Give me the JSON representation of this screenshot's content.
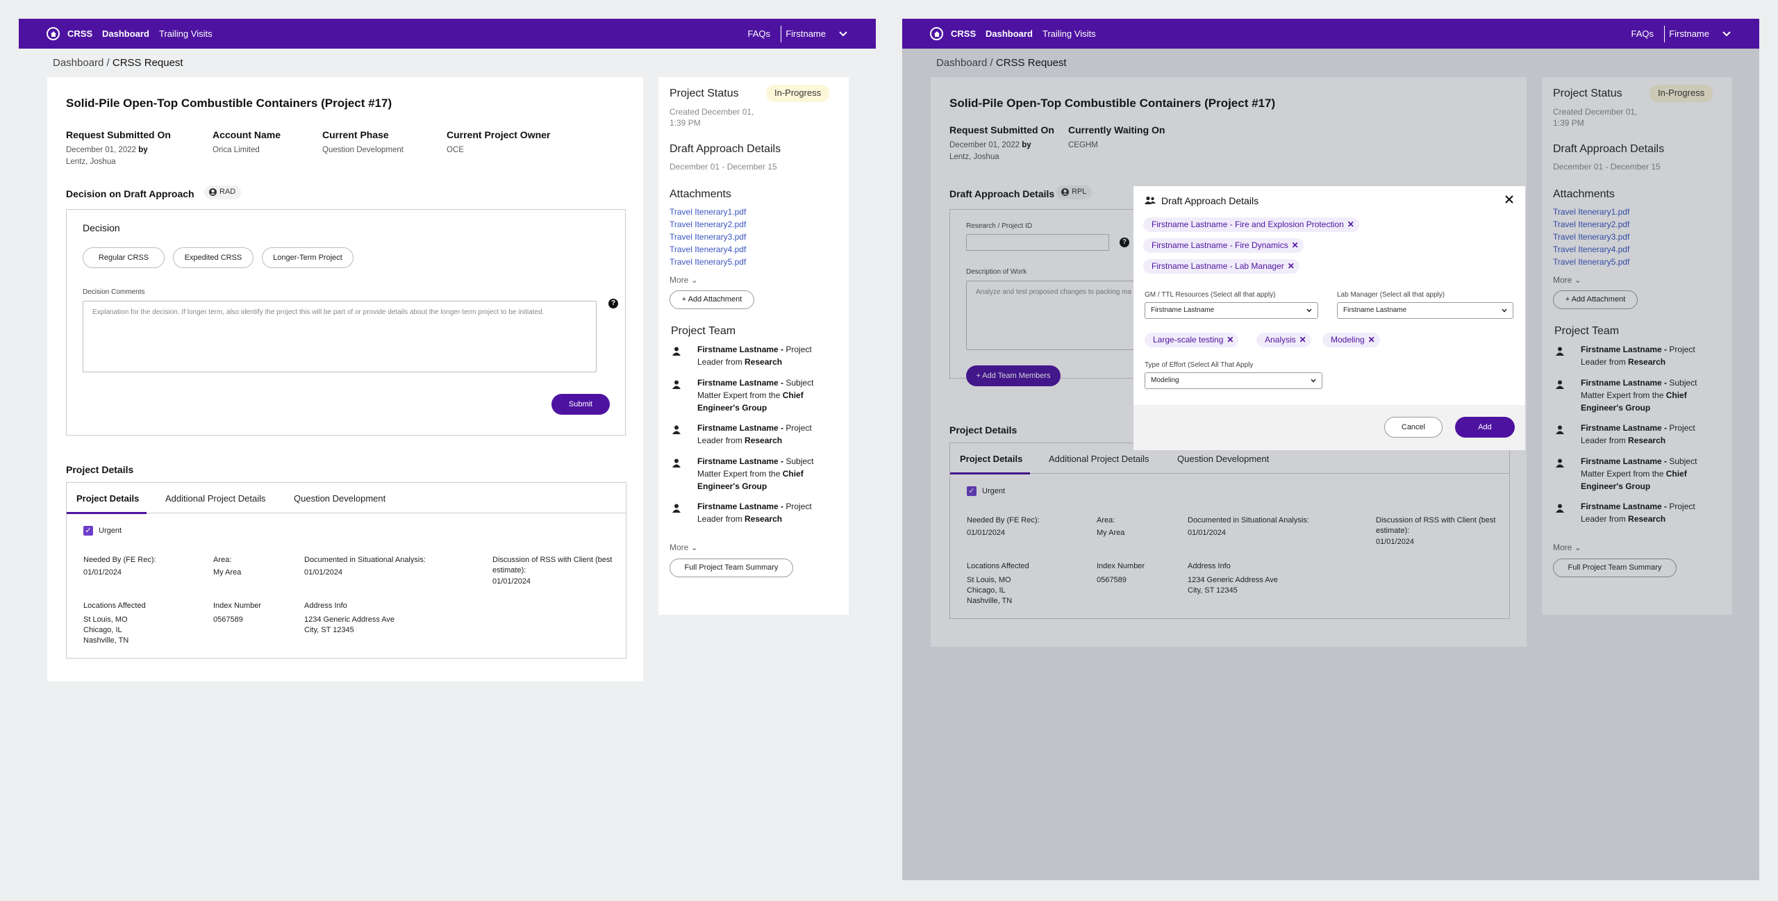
{
  "nav": {
    "brand": "CRSS",
    "dashboard": "Dashboard",
    "trailing_visits": "Trailing Visits",
    "faqs": "FAQs",
    "user": "Firstname"
  },
  "breadcrumb": {
    "root": "Dashboard / ",
    "current": "CRSS Request"
  },
  "colors": {
    "brand_purple": "#4d13a0",
    "status_bg": "#fdf7d9",
    "link": "#3a55c0"
  },
  "left": {
    "title": "Solid-Pile Open-Top Combustible Containers (Project #17)",
    "meta": [
      {
        "label": "Request Submitted On",
        "value": "December 01, 2022",
        "by": " by ",
        "name": "Lentz, Joshua"
      },
      {
        "label": "Account Name",
        "value": "Orica Limited"
      },
      {
        "label": "Current Phase",
        "value": "Question Development"
      },
      {
        "label": "Current Project Owner",
        "value": "OCE"
      }
    ],
    "decision_section": "Decision on Draft Approach",
    "decision_badge": "RAD",
    "decision": {
      "heading": "Decision",
      "options": [
        "Regular CRSS",
        "Expedited CRSS",
        "Longer-Term Project"
      ],
      "comments_label": "Decision Comments",
      "comments_placeholder": "Explanation for the decision. If longer term, also identify the project this will be part of or provide details about the longer-term project to be initiated.",
      "help": "?",
      "submit": "Submit"
    }
  },
  "right": {
    "title": "Solid-Pile Open-Top Combustible Containers (Project #17)",
    "meta": [
      {
        "label": "Request Submitted On",
        "value": "December 01, 2022",
        "by": " by ",
        "name": "Lentz, Joshua"
      },
      {
        "label": "Currently Waiting On",
        "value": "CEGHM"
      }
    ],
    "draft_section": "Draft Approach Details",
    "draft_badge": "RPL",
    "research_label": "Research / Project ID",
    "description_label": "Description of Work",
    "description_placeholder": "Analyze and test proposed changes to packing ma",
    "add_team": "+ Add Team Members"
  },
  "project_details": {
    "heading": "Project Details",
    "tabs": [
      "Project Details",
      "Additional Project Details",
      "Question Development"
    ],
    "urgent": "Urgent",
    "fields": [
      {
        "label": "Needed By (FE Rec):",
        "value": "01/01/2024"
      },
      {
        "label": "Area:",
        "value": "My Area"
      },
      {
        "label": "Documented in Situational Analysis:",
        "value": "01/01/2024"
      },
      {
        "label": "Discussion of RSS with Client (best estimate):",
        "value": "01/01/2024"
      }
    ],
    "fields2": [
      {
        "label": "Locations Affected",
        "lines": [
          "St Louis, MO",
          "Chicago, IL",
          "Nashville, TN"
        ]
      },
      {
        "label": "Index Number",
        "lines": [
          "0567589"
        ]
      },
      {
        "label": "Address Info",
        "lines": [
          "1234 Generic Address Ave",
          "City, ST 12345"
        ]
      }
    ]
  },
  "sidebar": {
    "status_label": "Project Status",
    "status_value": "In-Progress",
    "created": "Created December 01, 1:39 PM",
    "draft_title": "Draft Approach Details",
    "draft_dates": "December 01 - December 15",
    "attachments_title": "Attachments",
    "attachments": [
      "Travel Itenerary1.pdf",
      "Travel Itenerary2.pdf",
      "Travel Itenerary3.pdf",
      "Travel Itenerary4.pdf",
      "Travel Itenerary5.pdf"
    ],
    "more": "More",
    "add_attachment": "+ Add Attachment",
    "team_title": "Project Team",
    "team": [
      {
        "name": "Firstname Lastname -",
        "role": " Project Leader from ",
        "org": "Research"
      },
      {
        "name": "Firstname Lastname -",
        "role": " Subject Matter Expert from the ",
        "org": "Chief Engineer's Group"
      },
      {
        "name": "Firstname Lastname -",
        "role": " Project Leader from ",
        "org": "Research"
      },
      {
        "name": "Firstname Lastname -",
        "role": " Subject Matter Expert from the ",
        "org": "Chief Engineer's Group"
      },
      {
        "name": "Firstname Lastname -",
        "role": " Project Leader from ",
        "org": "Research"
      }
    ],
    "team_more": "More",
    "full_summary": "Full Project Team Summary"
  },
  "modal": {
    "title": "Draft Approach Details",
    "people": [
      "Firstname Lastname - Fire and Explosion Protection",
      "Firstname Lastname - Fire Dynamics",
      "Firstname Lastname - Lab Manager"
    ],
    "gm_label": "GM / TTL Resources (Select all that apply)",
    "gm_value": "Firstname Lastname",
    "lab_label": "Lab Manager (Select all that apply)",
    "lab_value": "Firstname Lastname",
    "efforts": [
      "Large-scale testing",
      "Analysis",
      "Modeling"
    ],
    "effort_label": "Type of Effort (Select All That Apply",
    "effort_value": "Modeling",
    "cancel": "Cancel",
    "add": "Add"
  }
}
